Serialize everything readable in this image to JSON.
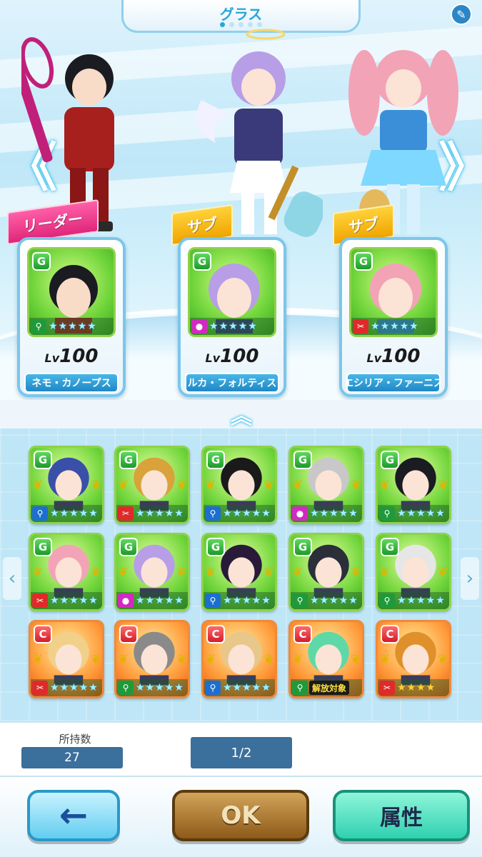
{
  "header": {
    "title": "グラス",
    "page_dots": 5,
    "active_dot": 0,
    "edit_icon": "pencil-icon"
  },
  "stage": {
    "left_arrow": "《",
    "right_arrow": "》",
    "characters": [
      {
        "role": "リーダー",
        "level_tag": "Lv",
        "level": "100",
        "name": "ネモ・カノープス",
        "grade": "G",
        "type": "green",
        "type_icon": "bottle-icon",
        "stars": 5,
        "hair": "#1b1b22"
      },
      {
        "role": "サブ",
        "level_tag": "Lv",
        "level": "100",
        "name": "ルカ・フォルティス",
        "grade": "G",
        "type": "pink",
        "type_icon": "ball-icon",
        "stars": 5,
        "hair": "#b79ee6"
      },
      {
        "role": "サブ",
        "level_tag": "Lv",
        "level": "100",
        "name": "エシリア・ファーニス",
        "grade": "G",
        "type": "red",
        "type_icon": "racket-icon",
        "stars": 5,
        "hair": "#f3a3b6"
      }
    ]
  },
  "collapse_icon": "︽",
  "list": {
    "left_arrow": "‹",
    "right_arrow": "›",
    "thumbs": [
      {
        "grade": "G",
        "type": "blue",
        "stars": 5,
        "hair": "#3a4fa8",
        "frame": "g"
      },
      {
        "grade": "G",
        "type": "red",
        "stars": 5,
        "hair": "#d9a23a",
        "frame": "g"
      },
      {
        "grade": "G",
        "type": "blue",
        "stars": 5,
        "hair": "#1a1a1a",
        "frame": "g"
      },
      {
        "grade": "G",
        "type": "pink",
        "stars": 5,
        "hair": "#c8c8c8",
        "frame": "g"
      },
      {
        "grade": "G",
        "type": "green",
        "stars": 5,
        "hair": "#1b1b22",
        "frame": "g"
      },
      {
        "grade": "G",
        "type": "red",
        "stars": 5,
        "hair": "#f3a3b6",
        "frame": "g"
      },
      {
        "grade": "G",
        "type": "pink",
        "stars": 5,
        "hair": "#b79ee6",
        "frame": "g"
      },
      {
        "grade": "G",
        "type": "blue",
        "stars": 5,
        "hair": "#2a1a3a",
        "frame": "g"
      },
      {
        "grade": "G",
        "type": "green",
        "stars": 5,
        "hair": "#2a2f3a",
        "frame": "g"
      },
      {
        "grade": "G",
        "type": "green",
        "stars": 5,
        "hair": "#e6e6e6",
        "frame": "g"
      },
      {
        "grade": "C",
        "type": "red",
        "stars": 5,
        "hair": "#f1d08a",
        "frame": "c"
      },
      {
        "grade": "C",
        "type": "green",
        "stars": 5,
        "hair": "#8a8a8a",
        "frame": "c"
      },
      {
        "grade": "C",
        "type": "blue",
        "stars": 5,
        "hair": "#e8c78a",
        "frame": "c"
      },
      {
        "grade": "C",
        "type": "green",
        "stars": 0,
        "hair": "#5fd8a8",
        "frame": "c",
        "tag": "解放対象"
      },
      {
        "grade": "C",
        "type": "red",
        "stars": 4,
        "hair": "#e0902a",
        "frame": "c",
        "gold": true
      }
    ]
  },
  "info": {
    "owned_label": "所持数",
    "owned_count": "27",
    "page": "1/2"
  },
  "buttons": {
    "back_icon": "←",
    "ok": "OK",
    "attribute": "属性"
  },
  "colors": {
    "accent": "#2aa5d8",
    "green_type": "#1f9a3a",
    "blue_type": "#1c6fd0",
    "red_type": "#e02a2a",
    "pink_type": "#d12ac0"
  }
}
